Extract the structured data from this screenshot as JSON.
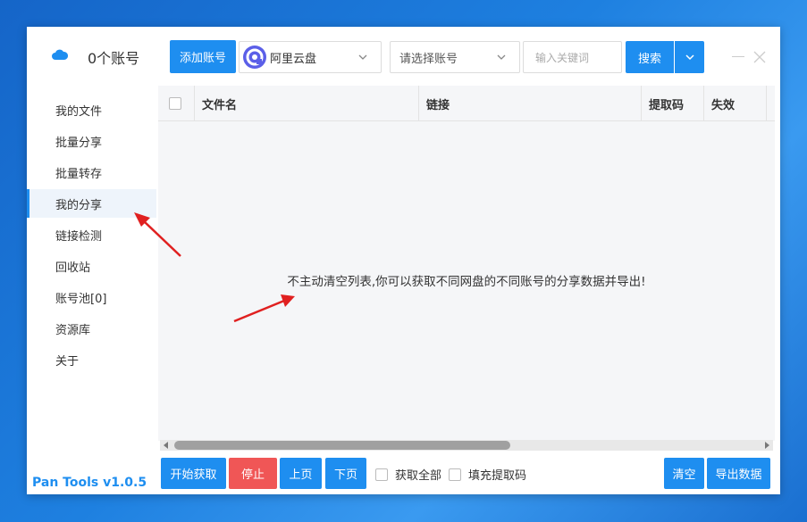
{
  "header": {
    "account_count": "0个账号",
    "add_account_label": "添加账号",
    "disk_select_value": "阿里云盘",
    "account_select_placeholder": "请选择账号",
    "keyword_placeholder": "输入关键词",
    "search_label": "搜索"
  },
  "sidebar": {
    "items": [
      {
        "label": "我的文件"
      },
      {
        "label": "批量分享"
      },
      {
        "label": "批量转存"
      },
      {
        "label": "我的分享"
      },
      {
        "label": "链接检测"
      },
      {
        "label": "回收站"
      },
      {
        "label": "账号池[0]"
      },
      {
        "label": "资源库"
      },
      {
        "label": "关于"
      }
    ],
    "active_index": 3,
    "version": "Pan Tools v1.0.5"
  },
  "table": {
    "columns": [
      "文件名",
      "链接",
      "提取码",
      "失效"
    ],
    "empty_message": "不主动清空列表,你可以获取不同网盘的不同账号的分享数据并导出!"
  },
  "footer": {
    "start_label": "开始获取",
    "stop_label": "停止",
    "prev_label": "上页",
    "next_label": "下页",
    "fetch_all_label": "获取全部",
    "fill_code_label": "填充提取码",
    "clear_label": "清空",
    "export_label": "导出数据"
  },
  "colors": {
    "accent": "#1e8ef0",
    "danger": "#f05656",
    "annotation_arrow": "#e02020"
  },
  "icons": [
    "cloud-icon",
    "aliyun-disk-icon",
    "chevron-down-icon",
    "minimize-icon",
    "close-icon"
  ]
}
